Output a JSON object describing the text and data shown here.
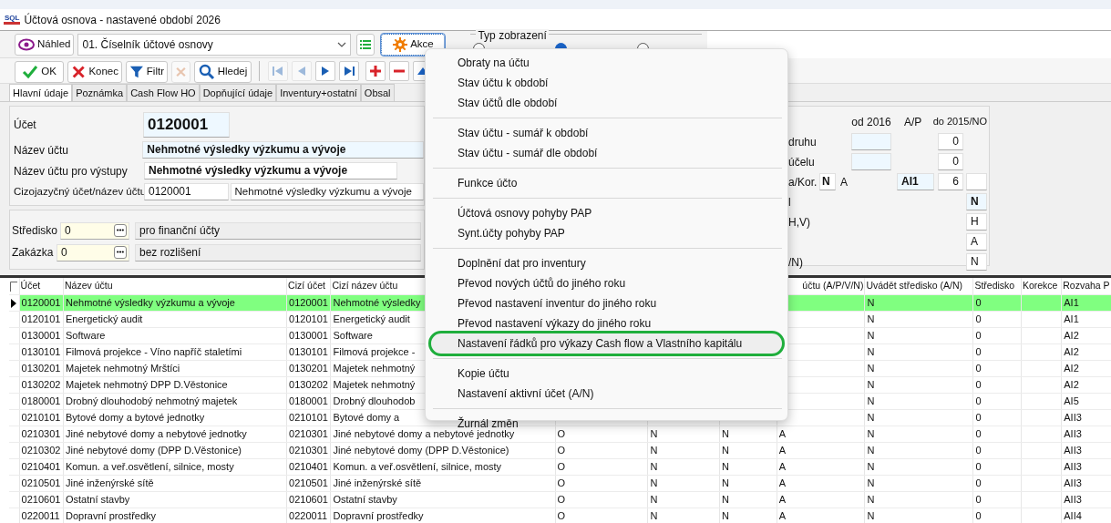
{
  "window": {
    "logo": "SQL",
    "title": "Účtová osnova - nastavené období 2026"
  },
  "toolbar": {
    "preview_button": "Náhled",
    "view_select": "01. Číselník účtové osnovy",
    "actions_button": "Akce",
    "view_type": {
      "label": "Typ zobrazení",
      "options": [
        {
          "selected": false
        },
        {
          "selected": true
        },
        {
          "selected": false
        }
      ]
    }
  },
  "actions_row": [
    {
      "label": "OK",
      "disabled": false
    },
    {
      "label": "Konec",
      "disabled": false
    },
    {
      "label": "Filtr",
      "disabled": false
    },
    {
      "disabled": true
    },
    {
      "label": "Hledej",
      "disabled": false
    }
  ],
  "nav_buttons": [
    {
      "disabled": true
    },
    {
      "disabled": true
    },
    {
      "disabled": false
    },
    {
      "disabled": false
    },
    {
      "disabled": false
    },
    {
      "disabled": false
    },
    {
      "disabled": false
    }
  ],
  "tabs": [
    {
      "label": "Hlavní údaje",
      "selected": true
    },
    {
      "label": "Poznámka",
      "selected": false
    },
    {
      "label": "Cash Flow HO",
      "selected": false
    },
    {
      "label": "Dopňující údaje",
      "selected": false
    },
    {
      "label": "Inventury+ostatní",
      "selected": false
    },
    {
      "label": "Obsal",
      "selected": false
    }
  ],
  "form": {
    "account": {
      "label": "Účet",
      "value": "0120001"
    },
    "name": {
      "label": "Název účtu",
      "value": "Nehmotné výsledky výzkumu a vývoje"
    },
    "output_name": {
      "label": "Název účtu pro výstupy",
      "value": "Nehmotné výsledky výzkumu a vývoje"
    },
    "foreign": {
      "label": "Cizojazyčný účet/název účtu",
      "account": "0120001",
      "name": "Nehmotné výsledky výzkumu a vývoje"
    },
    "cost_center": {
      "label": "Středisko",
      "value": "0",
      "description": "pro finanční účty"
    },
    "order": {
      "label": "Zakázka",
      "value": "0",
      "description": "bez rozlišení"
    }
  },
  "side_panel": {
    "col_from": "od 2016",
    "col_ap": "A/P",
    "col_to": "do 2015/NO",
    "type_label": "druhu",
    "type_to": "0",
    "purpose_label": "účelu",
    "purpose_to": "0",
    "kor_label": "a/Kor.",
    "kor_value": "N",
    "kor_flag": "A",
    "kor_ap": "AI1",
    "kor_to": "6",
    "flags": [
      {
        "label": "l",
        "value": "N"
      },
      {
        "label": "H,V)",
        "value": "H"
      },
      {
        "value": "A"
      },
      {
        "label": "/N)",
        "value": "N"
      }
    ]
  },
  "grid": {
    "columns": [
      "Účet",
      "Název účtu",
      "Cizí účet",
      "Cizí název účtu",
      null,
      null,
      null,
      "účtu (A/P/V/N)",
      "Uvádět středisko (A/N)",
      "Středisko",
      "Korekce",
      "Rozvaha P"
    ],
    "rows": [
      {
        "current": true,
        "cells": [
          "0120001",
          "Nehmotné výsledky výzkumu a vývoje",
          "0120001",
          "Nehmotné výsledky",
          null,
          null,
          null,
          null,
          "N",
          "0",
          null,
          "AI1"
        ]
      },
      {
        "current": false,
        "cells": [
          "0120101",
          "Energetický audit",
          "0120101",
          "Energetický audit",
          null,
          null,
          null,
          null,
          "N",
          "0",
          null,
          "AI1"
        ]
      },
      {
        "current": false,
        "cells": [
          "0130001",
          "Software",
          "0130001",
          "Software",
          null,
          null,
          null,
          null,
          "N",
          "0",
          null,
          "AI2"
        ]
      },
      {
        "current": false,
        "cells": [
          "0130101",
          "Filmová projekce - Víno napříč staletími",
          "0130101",
          "Filmová projekce -",
          null,
          null,
          null,
          null,
          "N",
          "0",
          null,
          "AI2"
        ]
      },
      {
        "current": false,
        "cells": [
          "0130201",
          "Majetek nehmotný Mrštíci",
          "0130201",
          "Majetek nehmotný",
          null,
          null,
          null,
          null,
          "N",
          "0",
          null,
          "AI2"
        ]
      },
      {
        "current": false,
        "cells": [
          "0130202",
          "Majetek nehmotný DPP D.Věstonice",
          "0130202",
          "Majetek nehmotný",
          null,
          null,
          null,
          null,
          "N",
          "0",
          null,
          "AI2"
        ]
      },
      {
        "current": false,
        "cells": [
          "0180001",
          "Drobný dlouhodobý nehmotný majetek",
          "0180001",
          "Drobný dlouhodob",
          null,
          null,
          null,
          null,
          "N",
          "0",
          null,
          "AI5"
        ]
      },
      {
        "current": false,
        "cells": [
          "0210101",
          "Bytové domy a bytové jednotky",
          "0210101",
          "Bytové domy a",
          null,
          null,
          null,
          null,
          "N",
          "0",
          null,
          "AII3"
        ]
      },
      {
        "current": false,
        "cells": [
          "0210301",
          "Jiné nebytové domy a nebytové jednotky",
          "0210301",
          "Jiné nebytové domy a nebytové jednotky",
          "O",
          "N",
          "N",
          "A",
          "N",
          "0",
          null,
          "AII3"
        ]
      },
      {
        "current": false,
        "cells": [
          "0210302",
          "Jiné nebytové domy (DPP D.Věstonice)",
          "0210301",
          "Jiné nebytové domy (DPP D.Věstonice)",
          "O",
          "N",
          "N",
          "A",
          "N",
          "0",
          null,
          "AII3"
        ]
      },
      {
        "current": false,
        "cells": [
          "0210401",
          "Komun. a veř.osvětlení, silnice, mosty",
          "0210401",
          "Komun. a veř.osvětlení, silnice, mosty",
          "O",
          "N",
          "N",
          "A",
          "N",
          "0",
          null,
          "AII3"
        ]
      },
      {
        "current": false,
        "cells": [
          "0210501",
          "Jiné inženýrské sítě",
          "0210501",
          "Jiné inženýrské sítě",
          "O",
          "N",
          "N",
          "A",
          "N",
          "0",
          null,
          "AII3"
        ]
      },
      {
        "current": false,
        "cells": [
          "0210601",
          "Ostatní stavby",
          "0210601",
          "Ostatní stavby",
          "O",
          "N",
          "N",
          "A",
          "N",
          "0",
          null,
          "AII3"
        ]
      },
      {
        "current": false,
        "cells": [
          "0220011",
          "Dopravní prostředky",
          "0220011",
          "Dopravní prostředky",
          "O",
          "N",
          "N",
          "A",
          "N",
          "0",
          null,
          "AII4"
        ]
      }
    ]
  },
  "context_menu": {
    "groups": [
      [
        {
          "label": "Obraty na účtu",
          "highlighted": false
        },
        {
          "label": "Stav účtu k období",
          "highlighted": false
        },
        {
          "label": "Stav účtů dle období",
          "highlighted": false
        }
      ],
      [
        {
          "label": "Stav účtu - sumář k období",
          "highlighted": false
        },
        {
          "label": "Stav účtu - sumář dle období",
          "highlighted": false
        }
      ],
      [
        {
          "label": "Funkce účto",
          "highlighted": false
        }
      ],
      [
        {
          "label": "Účtová osnovy pohyby PAP",
          "highlighted": false
        },
        {
          "label": "Synt.účty pohyby PAP",
          "highlighted": false
        }
      ],
      [
        {
          "label": "Doplnění dat pro inventury",
          "highlighted": false
        },
        {
          "label": "Převod nových účtů do jiného roku",
          "highlighted": false
        },
        {
          "label": "Převod nastavení inventur do jiného roku",
          "highlighted": false
        },
        {
          "label": "Převod nastavení výkazy do jiného roku",
          "highlighted": false
        },
        {
          "label": "Nastavení řádků pro výkazy Cash flow a Vlastního kapitálu",
          "highlighted": true
        }
      ],
      [
        {
          "label": "Kopie účtu",
          "highlighted": false
        },
        {
          "label": "Nastavení aktivní účet (A/N)",
          "highlighted": false
        }
      ],
      [
        {
          "label": "Žurnál změn",
          "highlighted": false
        }
      ]
    ]
  }
}
